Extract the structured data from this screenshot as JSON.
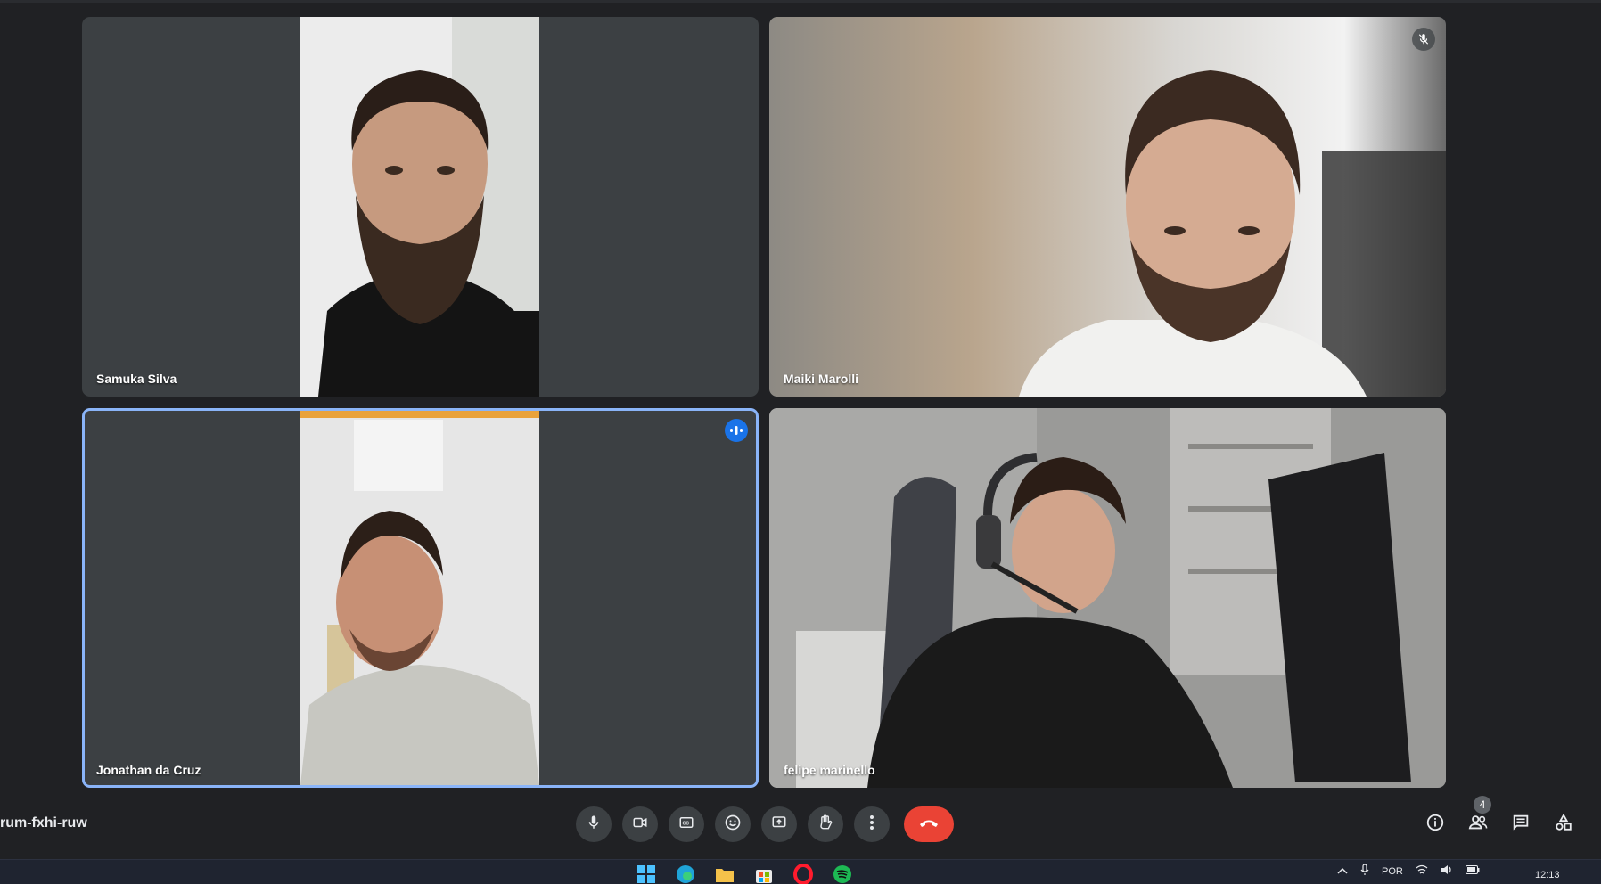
{
  "meeting": {
    "code": "rum-fxhi-ruw"
  },
  "participants": [
    {
      "name": "Samuka Silva"
    },
    {
      "name": "Maiki Marolli"
    },
    {
      "name": "Jonathan da Cruz"
    },
    {
      "name": "felipe marinello"
    }
  ],
  "people_count": "4",
  "colors": {
    "accent": "#8ab4f8",
    "end_call": "#ea4335",
    "speaking": "#1a73e8",
    "background": "#202124",
    "tile": "#3c4043"
  },
  "controls": [
    "mic-icon",
    "camera-icon",
    "captions-icon",
    "emoji-icon",
    "present-icon",
    "raise-hand-icon",
    "more-options-icon",
    "end-call-icon"
  ],
  "right_controls": [
    "info-icon",
    "people-icon",
    "chat-icon",
    "activities-icon"
  ],
  "taskbar": {
    "language": "POR",
    "time": "12:13"
  }
}
